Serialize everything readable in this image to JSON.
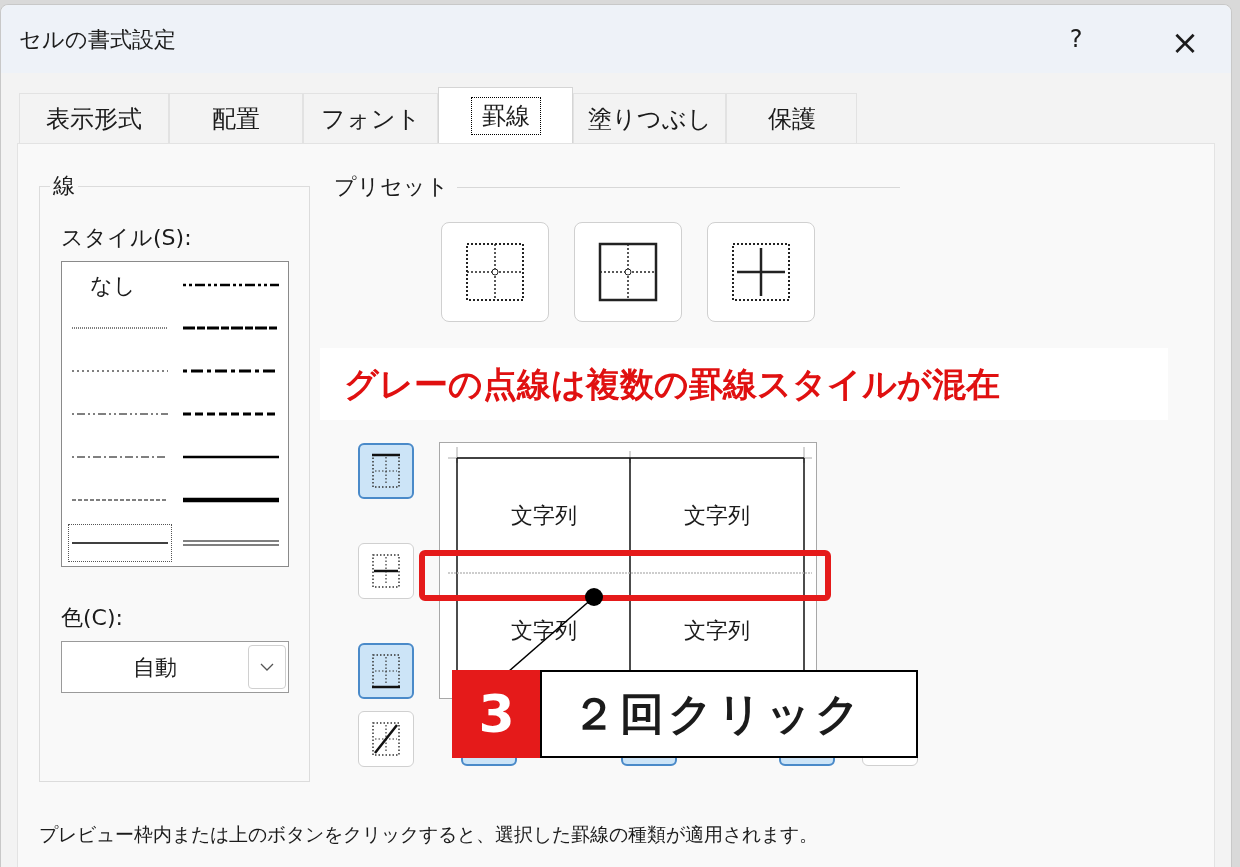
{
  "window": {
    "title": "セルの書式設定",
    "help": "?",
    "close": "×"
  },
  "tabs": [
    {
      "label": "表示形式",
      "selected": false
    },
    {
      "label": "配置",
      "selected": false
    },
    {
      "label": "フォント",
      "selected": false
    },
    {
      "label": "罫線",
      "selected": true
    },
    {
      "label": "塗りつぶし",
      "selected": false
    },
    {
      "label": "保護",
      "selected": false
    }
  ],
  "line_group": {
    "title": "線",
    "style_label": "スタイル(S):",
    "color_label": "色(C):",
    "color_value": "自動"
  },
  "line_styles": [
    {
      "kind": "none",
      "label": "なし",
      "selected": false
    },
    {
      "kind": "hair",
      "selected": false
    },
    {
      "kind": "dotted",
      "selected": false
    },
    {
      "kind": "dash_dot_dot",
      "selected": false
    },
    {
      "kind": "dash_dot",
      "selected": false
    },
    {
      "kind": "dashed",
      "selected": false
    },
    {
      "kind": "thin",
      "selected": true
    },
    {
      "kind": "medium_dash_dot_dot",
      "selected": false
    },
    {
      "kind": "slant_dash_dot",
      "selected": false
    },
    {
      "kind": "medium_dash_dot",
      "selected": false
    },
    {
      "kind": "medium_dashed",
      "selected": false
    },
    {
      "kind": "medium",
      "selected": false
    },
    {
      "kind": "thick",
      "selected": false
    },
    {
      "kind": "double",
      "selected": false
    }
  ],
  "preset_group": {
    "title": "プリセット"
  },
  "presets": [
    {
      "kind": "none"
    },
    {
      "kind": "outline"
    },
    {
      "kind": "inside"
    }
  ],
  "border_buttons_left": [
    {
      "kind": "top",
      "selected": true
    },
    {
      "kind": "middle",
      "selected": false
    },
    {
      "kind": "bottom",
      "selected": true
    },
    {
      "kind": "diagonal",
      "selected": false
    }
  ],
  "border_buttons_bottom": [
    {
      "selected": true
    },
    {
      "selected": true
    },
    {
      "selected": true
    },
    {
      "selected": false
    }
  ],
  "preview": {
    "cells": [
      "文字列",
      "文字列",
      "文字列",
      "文字列"
    ]
  },
  "preview_lines": [
    {
      "kind": "thin"
    },
    {
      "kind": "thin"
    },
    {
      "kind": "mixed"
    }
  ],
  "hint": "プレビュー枠内または上のボタンをクリックすると、選択した罫線の種類が適用されます。",
  "annotations": {
    "banner": "グレーの点線は複数の罫線スタイルが混在",
    "step_number": "3",
    "step_text": "２回クリック"
  }
}
